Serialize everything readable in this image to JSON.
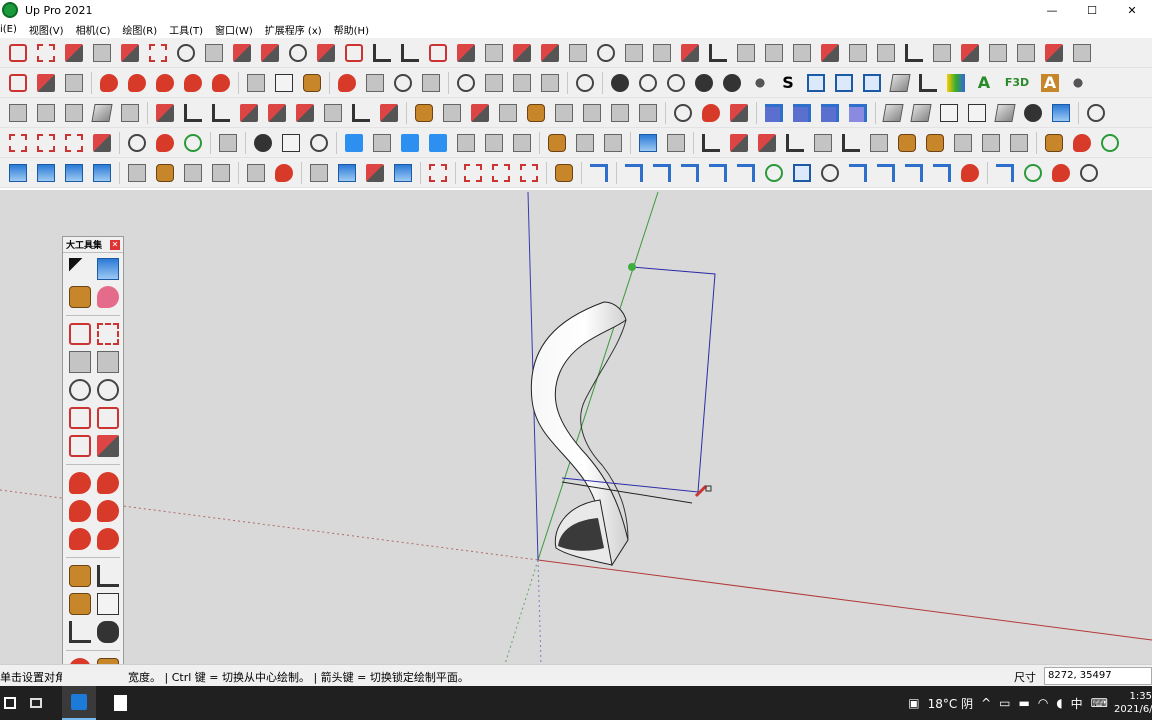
{
  "window": {
    "title": "Up Pro 2021",
    "controls": {
      "minimize": "—",
      "maximize": "☐",
      "close": "✕"
    }
  },
  "menu": {
    "items": [
      "i(E)",
      "视图(V)",
      "相机(C)",
      "绘图(R)",
      "工具(T)",
      "窗口(W)",
      "扩展程序 (x)",
      "帮助(H)"
    ]
  },
  "toolbar_icons": {
    "row4_text": "F3D",
    "row4_a": "A",
    "row4_s": "S"
  },
  "palette": {
    "title": "大工具集",
    "close": "✕",
    "tools": [
      "select-icon",
      "component-icon",
      "paint-bucket-icon",
      "eraser-icon",
      "line-icon",
      "freehand-icon",
      "rectangle-icon",
      "rotated-rectangle-icon",
      "circle-icon",
      "polygon-icon",
      "arc-icon",
      "two-point-arc-icon",
      "three-point-arc-icon",
      "pie-icon",
      "move-icon",
      "push-pull-icon",
      "rotate-icon",
      "follow-me-icon",
      "scale-icon",
      "offset-icon",
      "tape-measure-icon",
      "dimension-icon",
      "protractor-icon",
      "text-icon",
      "axes-icon",
      "3d-text-icon",
      "orbit-icon",
      "pan-icon",
      "zoom-icon",
      "zoom-window-icon"
    ]
  },
  "status": {
    "left_text": "单击设置对角线",
    "hint": "宽度。 | Ctrl 键 = 切换从中心绘制。 | 箭头键 = 切换锁定绘制平面。",
    "measure_label": "尺寸",
    "measure_value": "8272, 35497"
  },
  "taskbar": {
    "weather": "18°C 阴",
    "ime": "中",
    "time": "1:35",
    "date": "2021/6/"
  }
}
